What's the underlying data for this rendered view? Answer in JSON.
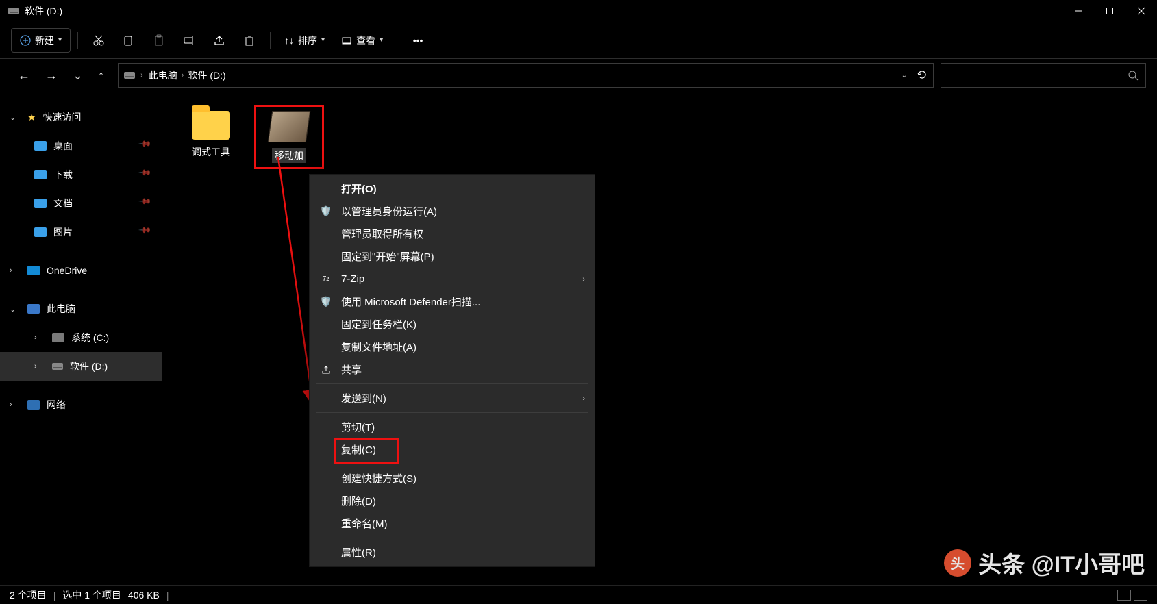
{
  "title": "软件 (D:)",
  "toolbar": {
    "new": "新建",
    "sort": "排序",
    "view": "查看"
  },
  "breadcrumb": {
    "pc": "此电脑",
    "drive": "软件 (D:)"
  },
  "sidebar": {
    "quick": "快速访问",
    "desktop": "桌面",
    "downloads": "下载",
    "documents": "文档",
    "pictures": "图片",
    "onedrive": "OneDrive",
    "thispc": "此电脑",
    "systemc": "系统 (C:)",
    "softwared": "软件 (D:)",
    "network": "网络"
  },
  "items": {
    "i0": "调式工具",
    "i1": "移动加"
  },
  "ctx": {
    "open": "打开(O)",
    "runadmin": "以管理员身份运行(A)",
    "adminown": "管理员取得所有权",
    "pinstart": "固定到\"开始\"屏幕(P)",
    "sevenzip": "7-Zip",
    "defender": "使用 Microsoft Defender扫描...",
    "pintaskbar": "固定到任务栏(K)",
    "copypath": "复制文件地址(A)",
    "share": "共享",
    "sendto": "发送到(N)",
    "cut": "剪切(T)",
    "copy": "复制(C)",
    "shortcut": "创建快捷方式(S)",
    "delete": "删除(D)",
    "rename": "重命名(M)",
    "properties": "属性(R)"
  },
  "status": {
    "items": "2 个项目",
    "selected": "选中 1 个项目",
    "size": "406 KB"
  },
  "watermark": "头条 @IT小哥吧"
}
